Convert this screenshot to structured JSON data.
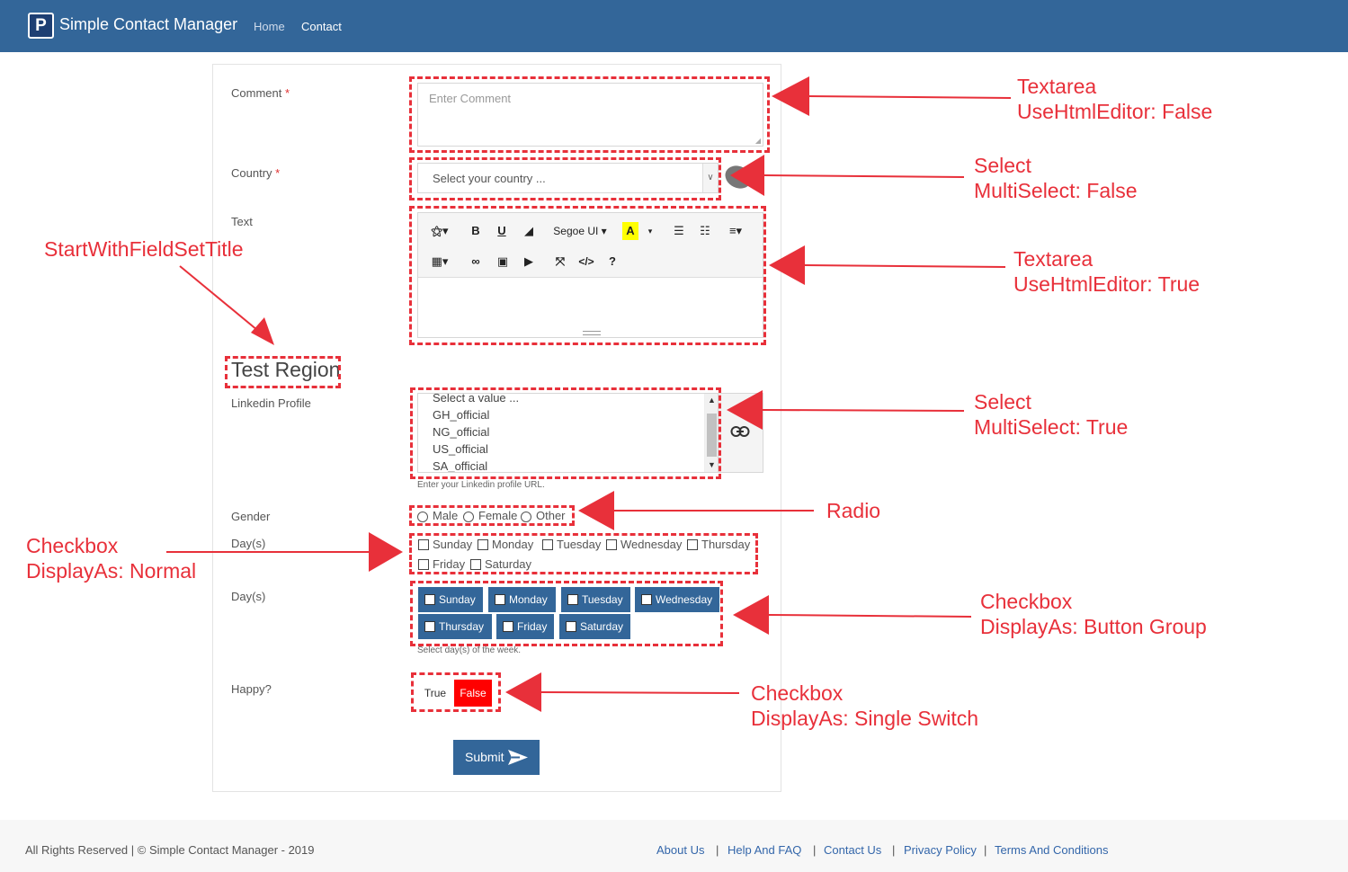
{
  "header": {
    "logo_letter": "P",
    "brand": "Simple Contact Manager",
    "nav": [
      "Home",
      "Contact"
    ]
  },
  "form": {
    "comment_label": "Comment",
    "required_mark": "*",
    "comment_placeholder": "Enter Comment",
    "country_label": "Country",
    "country_placeholder": "Select your country ...",
    "text_label": "Text",
    "editor": {
      "font_name": "Segoe UI",
      "help_icon": "?"
    },
    "region_title": "Test Region",
    "linkedin_label": "Linkedin Profile",
    "linkedin_options": [
      "Select a value ...",
      "GH_official",
      "NG_official",
      "US_official",
      "SA_official"
    ],
    "linkedin_help": "Enter your Linkedin profile URL.",
    "gender_label": "Gender",
    "gender_options": [
      "Male",
      "Female",
      "Other"
    ],
    "days_label": "Day(s)",
    "days_normal": [
      "Sunday",
      "Monday",
      "Tuesday",
      "Wednesday",
      "Thursday",
      "Friday",
      "Saturday"
    ],
    "days2_label": "Day(s)",
    "days_buttons": [
      "Sunday",
      "Monday",
      "Tuesday",
      "Wednesday",
      "Thursday",
      "Friday",
      "Saturday"
    ],
    "days_help": "Select day(s) of the week.",
    "happy_label": "Happy?",
    "switch_true": "True",
    "switch_false": "False",
    "submit_label": "Submit"
  },
  "annotations": {
    "textarea_plain": [
      "Textarea",
      "UseHtmlEditor: False"
    ],
    "select_single": [
      "Select",
      "MultiSelect: False"
    ],
    "textarea_html": [
      "Textarea",
      "UseHtmlEditor: True"
    ],
    "start_fieldset": "StartWithFieldSetTitle",
    "select_multi": [
      "Select",
      "MultiSelect: True"
    ],
    "radio": "Radio",
    "checkbox_normal": [
      "Checkbox",
      "DisplayAs: Normal"
    ],
    "checkbox_group": [
      "Checkbox",
      "DisplayAs: Button Group"
    ],
    "checkbox_switch": [
      "Checkbox",
      "DisplayAs: Single Switch"
    ]
  },
  "footer": {
    "copyright": "All Rights Reserved | © Simple Contact Manager - 2019",
    "links": [
      "About Us",
      "Help And FAQ",
      "Contact Us",
      "Privacy Policy",
      "Terms And Conditions"
    ],
    "separator": "|"
  },
  "colors": {
    "primary": "#336699",
    "annotation": "#e8303a",
    "switch_false": "#ff0000"
  }
}
